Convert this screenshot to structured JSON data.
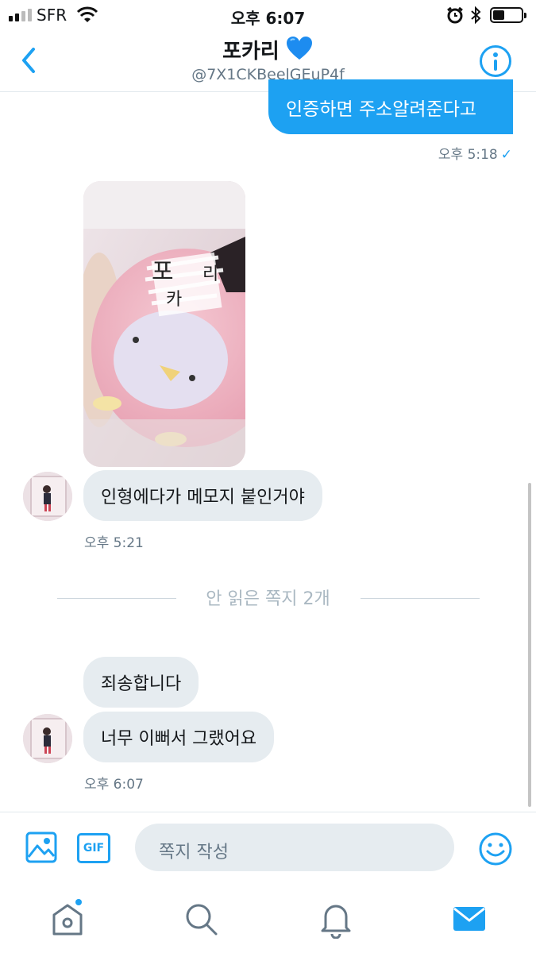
{
  "status_bar": {
    "carrier": "SFR",
    "time": "오후 6:07"
  },
  "header": {
    "name": "포카리",
    "handle": "@7X1CKBeelGEuP4f",
    "accent_color": "#1da1f2"
  },
  "messages": {
    "outgoing_text": "인증하면 주소알려준다고",
    "outgoing_time": "오후 5:18",
    "incoming_1_text": "인형에다가 메모지 붙인거야",
    "incoming_1_time": "오후 5:21",
    "unread_divider": "안 읽은 쪽지 2개",
    "incoming_2_text": "죄송합니다",
    "incoming_3_text": "너무 이뻐서 그랬어요",
    "incoming_3_time": "오후 6:07"
  },
  "composer": {
    "placeholder": "쪽지 작성",
    "gif_label": "GIF"
  },
  "tabbar": {
    "items": [
      "home-icon",
      "search-icon",
      "notifications-icon",
      "messages-icon"
    ],
    "active": "messages-icon"
  }
}
